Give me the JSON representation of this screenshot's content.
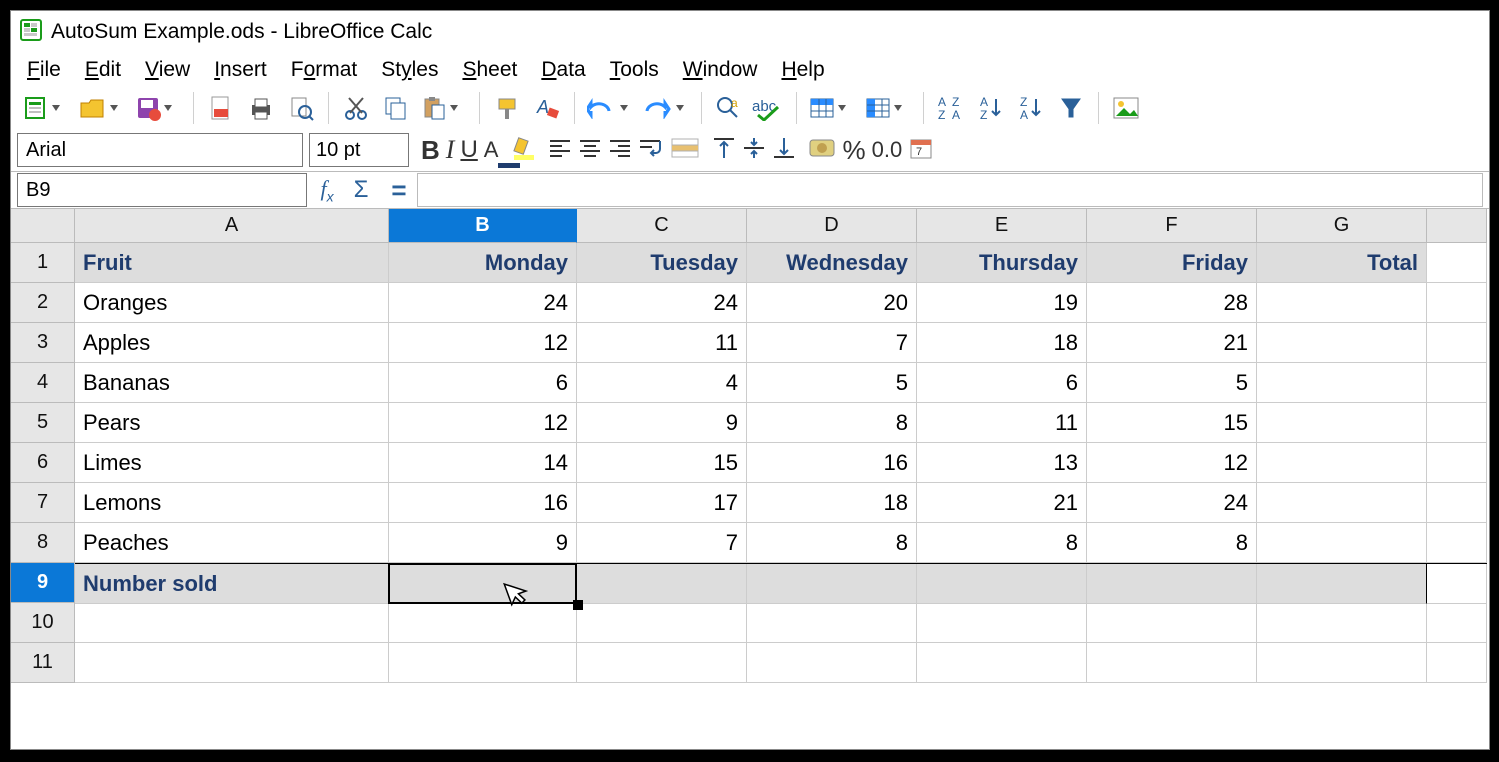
{
  "window": {
    "title": "AutoSum Example.ods - LibreOffice Calc"
  },
  "menu": {
    "items": [
      "File",
      "Edit",
      "View",
      "Insert",
      "Format",
      "Styles",
      "Sheet",
      "Data",
      "Tools",
      "Window",
      "Help"
    ]
  },
  "font": {
    "name": "Arial",
    "size": "10 pt"
  },
  "name_box": {
    "ref": "B9"
  },
  "columns": [
    "A",
    "B",
    "C",
    "D",
    "E",
    "F",
    "G"
  ],
  "selected_column_index": 1,
  "selected_row_index": 8,
  "rows": [
    "1",
    "2",
    "3",
    "4",
    "5",
    "6",
    "7",
    "8",
    "9",
    "10",
    "11"
  ],
  "sheet": {
    "headers": {
      "A": "Fruit",
      "B": "Monday",
      "C": "Tuesday",
      "D": "Wednesday",
      "E": "Thursday",
      "F": "Friday",
      "G": "Total"
    },
    "data": [
      {
        "A": "Oranges",
        "B": "24",
        "C": "24",
        "D": "20",
        "E": "19",
        "F": "28",
        "G": ""
      },
      {
        "A": "Apples",
        "B": "12",
        "C": "11",
        "D": "7",
        "E": "18",
        "F": "21",
        "G": ""
      },
      {
        "A": "Bananas",
        "B": "6",
        "C": "4",
        "D": "5",
        "E": "6",
        "F": "5",
        "G": ""
      },
      {
        "A": "Pears",
        "B": "12",
        "C": "9",
        "D": "8",
        "E": "11",
        "F": "15",
        "G": ""
      },
      {
        "A": "Limes",
        "B": "14",
        "C": "15",
        "D": "16",
        "E": "13",
        "F": "12",
        "G": ""
      },
      {
        "A": "Lemons",
        "B": "16",
        "C": "17",
        "D": "18",
        "E": "21",
        "F": "24",
        "G": ""
      },
      {
        "A": "Peaches",
        "B": "9",
        "C": "7",
        "D": "8",
        "E": "8",
        "F": "8",
        "G": ""
      }
    ],
    "summary_label": "Number sold"
  },
  "active_cell": {
    "col": "B",
    "row": 9
  }
}
